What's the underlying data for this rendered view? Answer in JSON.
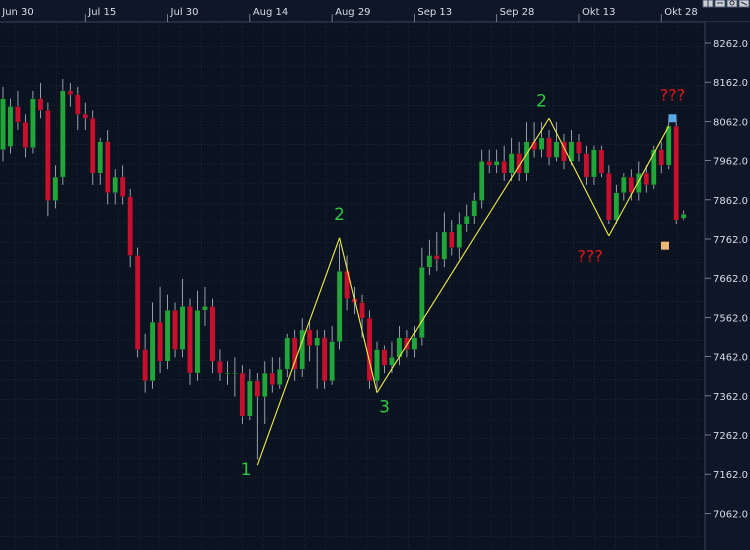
{
  "chart_data": {
    "type": "candlestick",
    "title": "",
    "xlabel": "",
    "ylabel": "",
    "ylim": [
      7010,
      8300
    ],
    "grid": true,
    "y_ticks": [
      8262,
      8162,
      8062,
      7962,
      7862,
      7762,
      7662,
      7562,
      7462,
      7362,
      7262,
      7162,
      7062
    ],
    "y_tick_labels": [
      "8262.0",
      "8162.0",
      "8062.0",
      "7962.0",
      "7862.0",
      "7762.0",
      "7662.0",
      "7562.0",
      "7462.0",
      "7362.0",
      "7262.0",
      "7162.0",
      "7062.0"
    ],
    "x_ticks": [
      {
        "label": "Jun 30",
        "index": -0.5
      },
      {
        "label": "Jul 15",
        "index": 11
      },
      {
        "label": "Jul 30",
        "index": 22
      },
      {
        "label": "Aug 14",
        "index": 33
      },
      {
        "label": "Aug 29",
        "index": 44
      },
      {
        "label": "Sep 13",
        "index": 55
      },
      {
        "label": "Sep 28",
        "index": 66
      },
      {
        "label": "Okt 13",
        "index": 77
      },
      {
        "label": "Okt 28",
        "index": 88
      }
    ],
    "candles": [
      [
        7990,
        8120,
        8150,
        7960
      ],
      [
        7998,
        8100,
        8120,
        7980
      ],
      [
        8100,
        8060,
        8140,
        8040
      ],
      [
        8060,
        7995,
        8080,
        7970
      ],
      [
        7995,
        8120,
        8140,
        7980
      ],
      [
        8120,
        8090,
        8160,
        8070
      ],
      [
        8090,
        7860,
        8110,
        7820
      ],
      [
        7860,
        7920,
        7950,
        7840
      ],
      [
        7920,
        8140,
        8170,
        7900
      ],
      [
        8140,
        8130,
        8160,
        8100
      ],
      [
        8130,
        8080,
        8150,
        8040
      ],
      [
        8080,
        8070,
        8110,
        8040
      ],
      [
        8070,
        7930,
        8090,
        7900
      ],
      [
        7930,
        8010,
        8020,
        7900
      ],
      [
        8010,
        7880,
        8040,
        7850
      ],
      [
        7880,
        7920,
        7940,
        7850
      ],
      [
        7920,
        7870,
        7950,
        7850
      ],
      [
        7870,
        7720,
        7890,
        7690
      ],
      [
        7720,
        7480,
        7740,
        7460
      ],
      [
        7480,
        7400,
        7520,
        7370
      ],
      [
        7400,
        7550,
        7600,
        7380
      ],
      [
        7550,
        7450,
        7640,
        7420
      ],
      [
        7450,
        7580,
        7620,
        7430
      ],
      [
        7580,
        7480,
        7600,
        7460
      ],
      [
        7480,
        7590,
        7660,
        7460
      ],
      [
        7590,
        7420,
        7610,
        7390
      ],
      [
        7420,
        7580,
        7630,
        7400
      ],
      [
        7580,
        7590,
        7640,
        7540
      ],
      [
        7590,
        7450,
        7610,
        7420
      ],
      [
        7450,
        7420,
        7480,
        7400
      ],
      [
        7420,
        7420,
        7450,
        7390
      ],
      [
        7420,
        7420,
        7460,
        7360
      ],
      [
        7420,
        7310,
        7440,
        7290
      ],
      [
        7310,
        7400,
        7430,
        7300
      ],
      [
        7400,
        7360,
        7420,
        7200
      ],
      [
        7360,
        7420,
        7450,
        7290
      ],
      [
        7420,
        7390,
        7460,
        7370
      ],
      [
        7390,
        7430,
        7460,
        7380
      ],
      [
        7430,
        7510,
        7520,
        7410
      ],
      [
        7510,
        7430,
        7530,
        7400
      ],
      [
        7430,
        7530,
        7560,
        7410
      ],
      [
        7530,
        7490,
        7550,
        7450
      ],
      [
        7490,
        7510,
        7530,
        7380
      ],
      [
        7510,
        7400,
        7530,
        7380
      ],
      [
        7400,
        7500,
        7540,
        7390
      ],
      [
        7500,
        7680,
        7750,
        7480
      ],
      [
        7680,
        7610,
        7720,
        7580
      ],
      [
        7610,
        7600,
        7640,
        7570
      ],
      [
        7600,
        7560,
        7620,
        7510
      ],
      [
        7560,
        7400,
        7580,
        7380
      ],
      [
        7400,
        7480,
        7500,
        7380
      ],
      [
        7480,
        7440,
        7490,
        7420
      ],
      [
        7440,
        7460,
        7500,
        7420
      ],
      [
        7460,
        7510,
        7540,
        7440
      ],
      [
        7510,
        7480,
        7530,
        7460
      ],
      [
        7480,
        7510,
        7540,
        7460
      ],
      [
        7510,
        7690,
        7740,
        7490
      ],
      [
        7690,
        7720,
        7760,
        7670
      ],
      [
        7720,
        7710,
        7780,
        7680
      ],
      [
        7710,
        7780,
        7830,
        7690
      ],
      [
        7780,
        7740,
        7810,
        7720
      ],
      [
        7740,
        7800,
        7830,
        7710
      ],
      [
        7800,
        7820,
        7850,
        7780
      ],
      [
        7820,
        7860,
        7880,
        7800
      ],
      [
        7860,
        7960,
        7990,
        7840
      ],
      [
        7960,
        7950,
        7990,
        7930
      ],
      [
        7950,
        7960,
        7990,
        7930
      ],
      [
        7960,
        7930,
        8000,
        7910
      ],
      [
        7930,
        7980,
        8020,
        7910
      ],
      [
        7980,
        7930,
        8010,
        7910
      ],
      [
        7930,
        8010,
        8060,
        7910
      ],
      [
        8010,
        7990,
        8060,
        7970
      ],
      [
        7990,
        8020,
        8060,
        7970
      ],
      [
        8020,
        7970,
        8040,
        7950
      ],
      [
        7970,
        8010,
        8060,
        7960
      ],
      [
        8010,
        7960,
        8030,
        7940
      ],
      [
        7960,
        8010,
        8040,
        7950
      ],
      [
        8010,
        7980,
        8030,
        7960
      ],
      [
        7980,
        7920,
        8000,
        7900
      ],
      [
        7920,
        7990,
        8000,
        7900
      ],
      [
        7990,
        7930,
        8000,
        7920
      ],
      [
        7930,
        7810,
        7950,
        7800
      ],
      [
        7810,
        7880,
        7900,
        7800
      ],
      [
        7880,
        7920,
        7930,
        7860
      ],
      [
        7920,
        7880,
        7940,
        7860
      ],
      [
        7880,
        7930,
        7960,
        7860
      ],
      [
        7930,
        7900,
        7950,
        7880
      ],
      [
        7900,
        7990,
        8000,
        7890
      ],
      [
        7990,
        7950,
        8010,
        7930
      ],
      [
        7950,
        8050,
        8070,
        7940
      ],
      [
        8050,
        7810,
        8070,
        7800
      ],
      [
        7815,
        7825,
        7835,
        7810
      ]
    ],
    "zigzag_lines": [
      [
        {
          "i": 34,
          "v": 7185
        },
        {
          "i": 45,
          "v": 7765
        }
      ],
      [
        {
          "i": 45,
          "v": 7765
        },
        {
          "i": 50,
          "v": 7370
        }
      ],
      [
        {
          "i": 50,
          "v": 7370
        },
        {
          "i": 73,
          "v": 8070
        }
      ],
      [
        {
          "i": 73,
          "v": 8070
        },
        {
          "i": 81,
          "v": 7770
        }
      ],
      [
        {
          "i": 81,
          "v": 7770
        },
        {
          "i": 89,
          "v": 8050
        }
      ]
    ],
    "annotations": [
      {
        "text": "1",
        "i": 32.5,
        "v": 7160,
        "color": "green"
      },
      {
        "text": "2",
        "i": 45,
        "v": 7810,
        "color": "green"
      },
      {
        "text": "3",
        "i": 51,
        "v": 7320,
        "color": "green"
      },
      {
        "text": "2",
        "i": 72,
        "v": 8100,
        "color": "green"
      },
      {
        "text": "???",
        "i": 78.5,
        "v": 7705,
        "color": "red"
      },
      {
        "text": "???",
        "i": 89.5,
        "v": 8115,
        "color": "red"
      }
    ],
    "markers": [
      {
        "i": 89.5,
        "v": 8070,
        "color": "#5aa9e6",
        "shape": "square"
      },
      {
        "i": 88.5,
        "v": 7745,
        "color": "#f0b67a",
        "shape": "square"
      }
    ],
    "colors": {
      "background": "#0b1220",
      "grid": "#2a3446",
      "bull": "#21a63a",
      "bear": "#c8102e",
      "zigzag": "#f2ee4a",
      "annotation_green": "#2ecc40",
      "annotation_red": "#e01818"
    }
  },
  "toolbar": {
    "icons": [
      "crosshair-icon",
      "zoom-in-icon",
      "zoom-out-icon",
      "settings-icon"
    ]
  }
}
